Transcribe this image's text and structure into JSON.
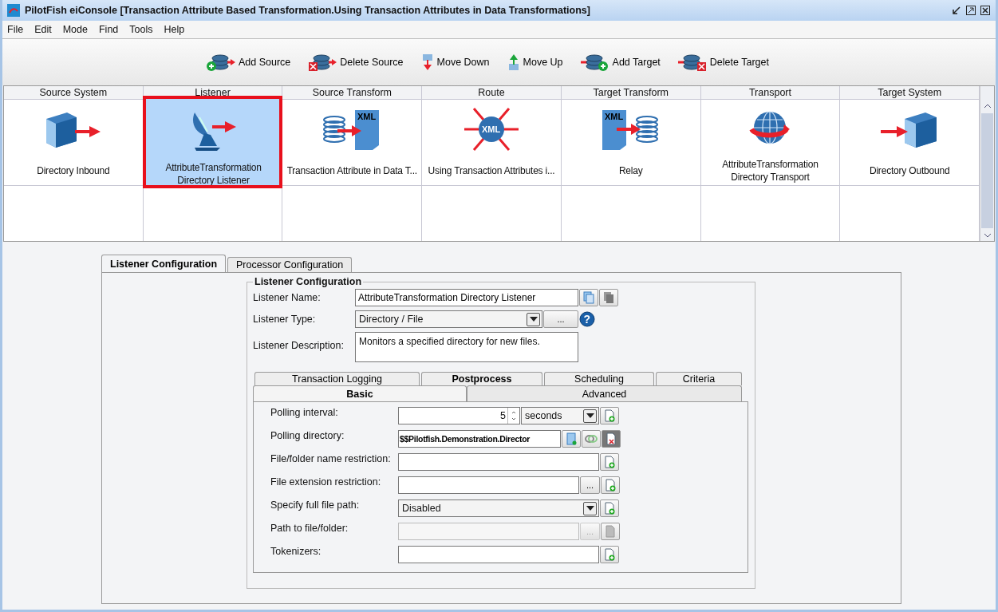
{
  "window": {
    "title": "PilotFish eiConsole [Transaction Attribute Based Transformation.Using Transaction Attributes in Data Transformations]"
  },
  "menu": [
    "File",
    "Edit",
    "Mode",
    "Find",
    "Tools",
    "Help"
  ],
  "toolbar": [
    {
      "label": "Add Source",
      "kind": "add-source"
    },
    {
      "label": "Delete Source",
      "kind": "delete-source"
    },
    {
      "label": "Move Down",
      "kind": "move-down"
    },
    {
      "label": "Move Up",
      "kind": "move-up"
    },
    {
      "label": "Add Target",
      "kind": "add-target"
    },
    {
      "label": "Delete Target",
      "kind": "delete-target"
    }
  ],
  "stages": [
    {
      "header": "Source System",
      "kind": "server-out",
      "label_lines": [
        "Directory Inbound"
      ],
      "selected": false
    },
    {
      "header": "Listener",
      "kind": "dish",
      "label_lines": [
        "AttributeTransformation",
        "Directory Listener"
      ],
      "selected": true
    },
    {
      "header": "Source Transform",
      "kind": "db-to-xml",
      "icon_text": "XML",
      "label_lines": [
        "Transaction Attribute in Data T..."
      ],
      "selected": false
    },
    {
      "header": "Route",
      "kind": "xml-hub",
      "icon_text": "XML",
      "label_lines": [
        "Using Transaction Attributes i..."
      ],
      "selected": false
    },
    {
      "header": "Target Transform",
      "kind": "xml-to-db",
      "icon_text": "XML",
      "label_lines": [
        "Relay"
      ],
      "selected": false
    },
    {
      "header": "Transport",
      "kind": "globe",
      "label_lines": [
        "AttributeTransformation",
        "Directory Transport"
      ],
      "selected": false
    },
    {
      "header": "Target System",
      "kind": "server-in",
      "label_lines": [
        "Directory Outbound"
      ],
      "selected": false
    }
  ],
  "config_tabs": [
    {
      "label": "Listener Configuration",
      "selected": true
    },
    {
      "label": "Processor Configuration",
      "selected": false
    }
  ],
  "group": {
    "title": "Listener Configuration",
    "name": {
      "label": "Listener Name:",
      "value": "AttributeTransformation Directory Listener"
    },
    "type": {
      "label": "Listener Type:",
      "value": "Directory / File",
      "button": "...",
      "help": "?"
    },
    "description": {
      "label": "Listener Description:",
      "value": "Monitors a specified directory for new files."
    }
  },
  "sub_tabs_back": [
    {
      "label": "Transaction Logging",
      "modified": false
    },
    {
      "label": "Postprocess",
      "modified": true
    },
    {
      "label": "Scheduling",
      "modified": false
    },
    {
      "label": "Criteria",
      "modified": false
    }
  ],
  "sub_tabs_front": [
    {
      "label": "Basic",
      "selected": true
    },
    {
      "label": "Advanced",
      "selected": false
    }
  ],
  "fields": [
    {
      "label": "Polling interval:",
      "kind": "spinner",
      "value": "5",
      "unit": "seconds"
    },
    {
      "label": "Polling directory:",
      "kind": "variable",
      "value": "$$Pilotfish.Demonstration.Director"
    },
    {
      "label": "File/folder name restriction:",
      "kind": "text",
      "disabled": false
    },
    {
      "label": "File extension restriction:",
      "kind": "browse",
      "button": "...",
      "disabled": false
    },
    {
      "label": "Specify full file path:",
      "kind": "select",
      "value": "Disabled"
    },
    {
      "label": "Path to file/folder:",
      "kind": "browse",
      "button": "...",
      "disabled": true
    },
    {
      "label": "Tokenizers:",
      "kind": "text",
      "disabled": false
    }
  ]
}
